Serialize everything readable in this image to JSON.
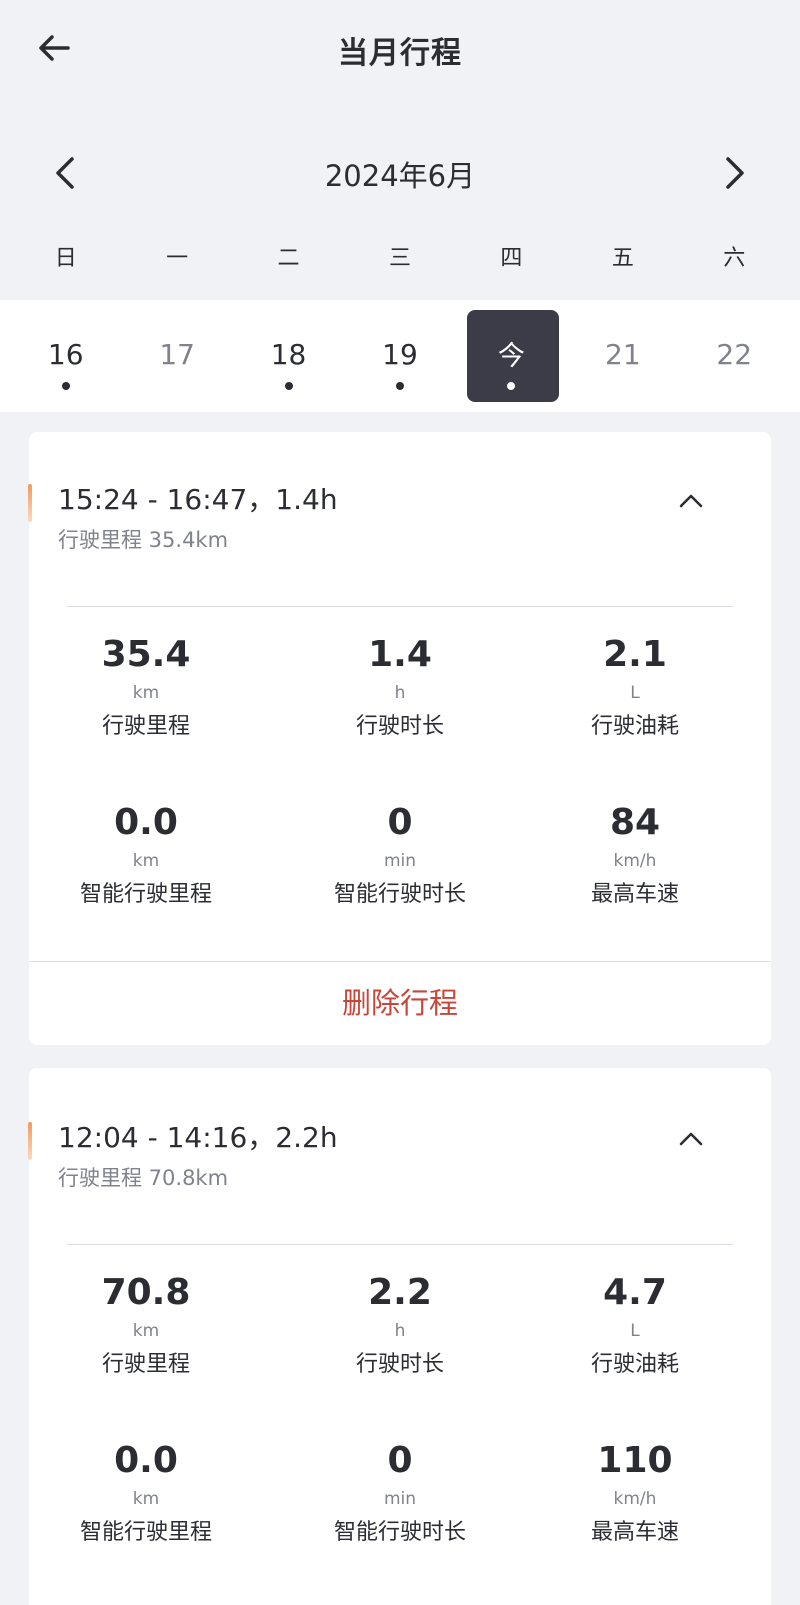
{
  "header": {
    "title": "当月行程"
  },
  "calendar": {
    "month_label": "2024年6月",
    "weekdays": [
      "日",
      "一",
      "二",
      "三",
      "四",
      "五",
      "六"
    ],
    "dates": [
      {
        "label": "16",
        "has_trip": true
      },
      {
        "label": "17",
        "has_trip": false
      },
      {
        "label": "18",
        "has_trip": true
      },
      {
        "label": "19",
        "has_trip": true
      },
      {
        "label": "今",
        "has_trip": true,
        "selected": true
      },
      {
        "label": "21",
        "has_trip": false
      },
      {
        "label": "22",
        "has_trip": false
      }
    ]
  },
  "trips": [
    {
      "time": "15:24 - 16:47，1.4h",
      "subtitle": "行驶里程 35.4km",
      "stats": [
        {
          "value": "35.4",
          "unit": "km",
          "label": "行驶里程"
        },
        {
          "value": "1.4",
          "unit": "h",
          "label": "行驶时长"
        },
        {
          "value": "2.1",
          "unit": "L",
          "label": "行驶油耗"
        },
        {
          "value": "0.0",
          "unit": "km",
          "label": "智能行驶里程"
        },
        {
          "value": "0",
          "unit": "min",
          "label": "智能行驶时长"
        },
        {
          "value": "84",
          "unit": "km/h",
          "label": "最高车速"
        }
      ],
      "delete_label": "删除行程"
    },
    {
      "time": "12:04 - 14:16，2.2h",
      "subtitle": "行驶里程 70.8km",
      "stats": [
        {
          "value": "70.8",
          "unit": "km",
          "label": "行驶里程"
        },
        {
          "value": "2.2",
          "unit": "h",
          "label": "行驶时长"
        },
        {
          "value": "4.7",
          "unit": "L",
          "label": "行驶油耗"
        },
        {
          "value": "0.0",
          "unit": "km",
          "label": "智能行驶里程"
        },
        {
          "value": "0",
          "unit": "min",
          "label": "智能行驶时长"
        },
        {
          "value": "110",
          "unit": "km/h",
          "label": "最高车速"
        }
      ]
    }
  ],
  "colors": {
    "background": "#f1f2f6",
    "text": "#2b2d33",
    "muted": "#80838b",
    "today_bg": "#3b3c48",
    "danger": "#c6463a",
    "accent": "#f09a5e"
  }
}
